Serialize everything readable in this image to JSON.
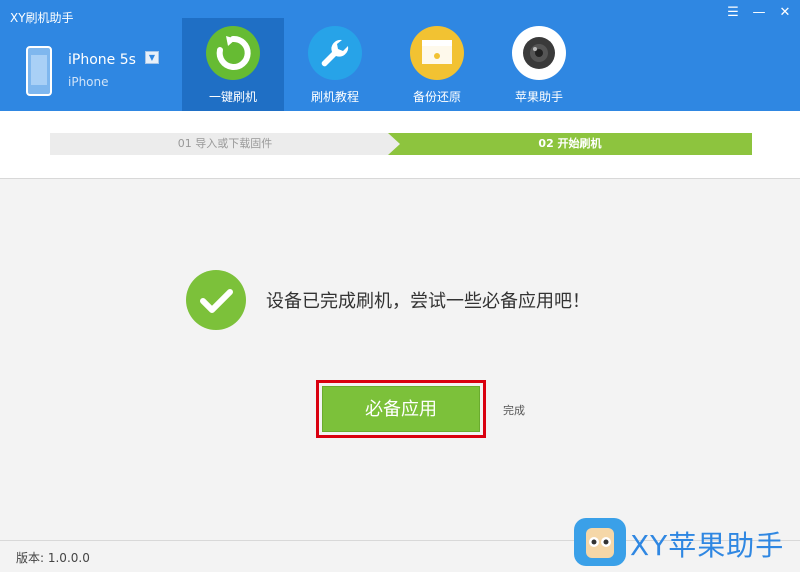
{
  "window": {
    "title": "XY刷机助手",
    "controls": [
      "menu-icon",
      "minimize-icon",
      "close-icon"
    ]
  },
  "device": {
    "name": "iPhone 5s",
    "type": "iPhone"
  },
  "nav": {
    "items": [
      {
        "label": "一键刷机",
        "icon": "refresh-icon",
        "color": "#66bb33"
      },
      {
        "label": "刷机教程",
        "icon": "wrench-icon",
        "color": "#27a3e8"
      },
      {
        "label": "备份还原",
        "icon": "folder-icon",
        "color": "#f2c232"
      },
      {
        "label": "苹果助手",
        "icon": "camera-icon",
        "color": "#ffffff"
      }
    ]
  },
  "steps": {
    "step1": "01 导入或下载固件",
    "step2": "02 开始刷机"
  },
  "main": {
    "message": "设备已完成刷机，尝试一些必备应用吧！",
    "primary_button": "必备应用",
    "done_link": "完成"
  },
  "footer": {
    "version": "版本: 1.0.0.0"
  },
  "watermark": {
    "text": "XY苹果助手"
  },
  "colors": {
    "header": "#2f87e2",
    "accent_green": "#7cc13a",
    "highlight_red": "#d9000f"
  }
}
